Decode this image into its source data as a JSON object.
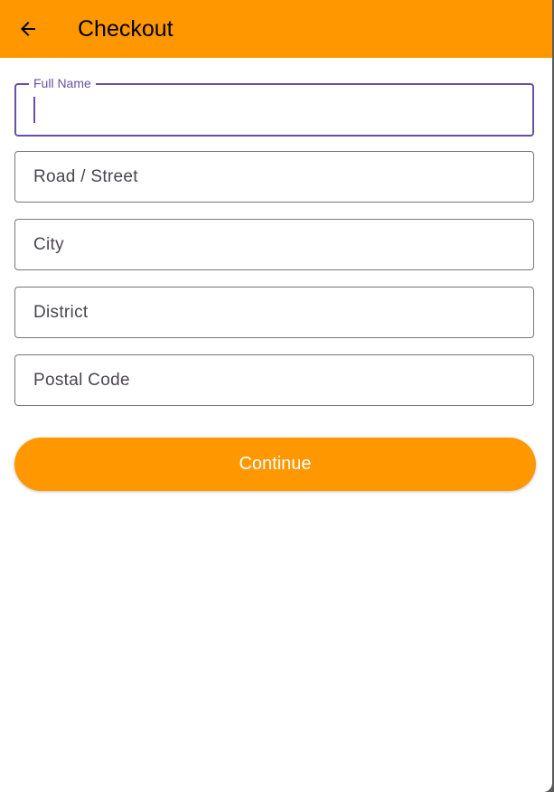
{
  "appbar": {
    "title": "Checkout",
    "back_icon": "arrow-left-icon"
  },
  "form": {
    "full_name": {
      "label": "Full Name",
      "value": ""
    },
    "road": {
      "placeholder": "Road / Street"
    },
    "city": {
      "placeholder": "City"
    },
    "district": {
      "placeholder": "District"
    },
    "postal": {
      "placeholder": "Postal Code"
    }
  },
  "continue_label": "Continue",
  "colors": {
    "accent": "#ff9800",
    "focus": "#6750a4"
  }
}
